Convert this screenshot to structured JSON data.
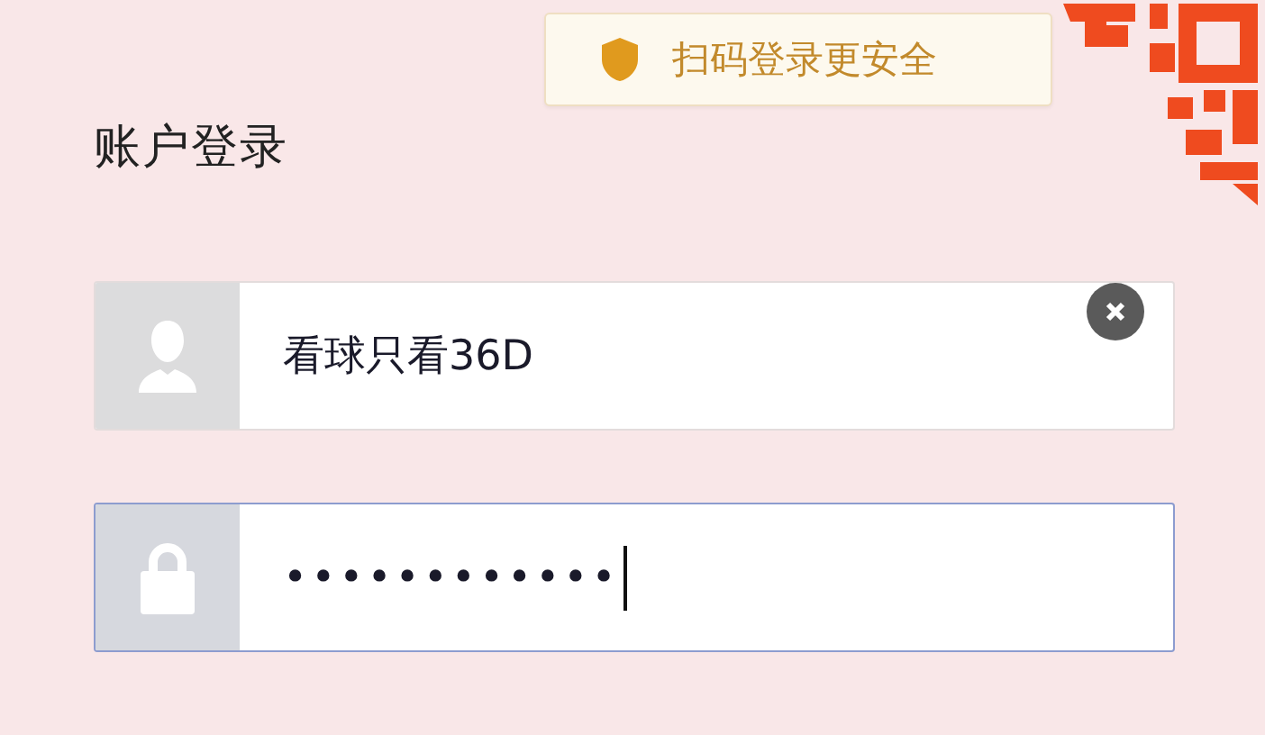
{
  "qr_hint": {
    "text": "扫码登录更安全"
  },
  "title": "账户登录",
  "fields": [
    {
      "kind": "username",
      "value": "看球只看36D",
      "focused": false,
      "clearable": true
    },
    {
      "kind": "password",
      "value": "••••••••••••",
      "focused": true,
      "clearable": false
    }
  ]
}
